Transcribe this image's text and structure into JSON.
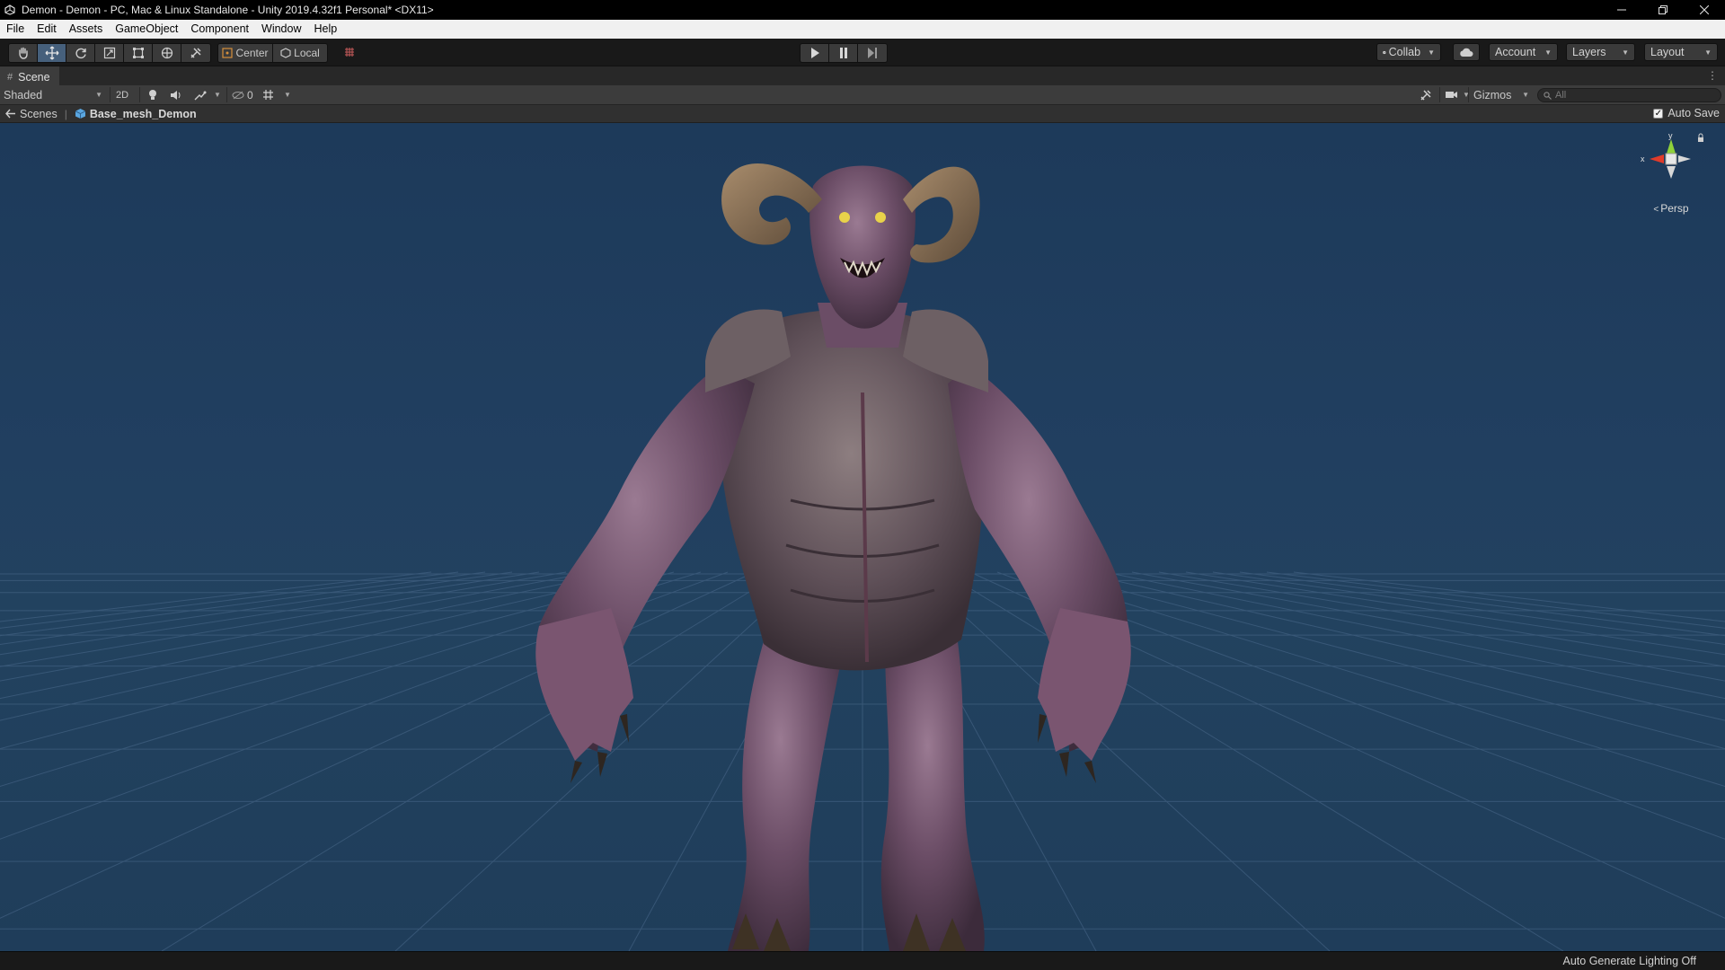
{
  "window": {
    "title": "Demon - Demon - PC, Mac & Linux Standalone - Unity 2019.4.32f1 Personal* <DX11>"
  },
  "menu": [
    "File",
    "Edit",
    "Assets",
    "GameObject",
    "Component",
    "Window",
    "Help"
  ],
  "toolbar": {
    "tools": [
      "hand-tool",
      "move-tool",
      "rotate-tool",
      "scale-tool",
      "rect-tool",
      "transform-tool",
      "custom-tool"
    ],
    "active_tool": "move-tool",
    "pivot_label": "Center",
    "space_label": "Local",
    "collab_label": "Collab",
    "account_label": "Account",
    "layers_label": "Layers",
    "layout_label": "Layout"
  },
  "scene_tab": {
    "label": "Scene"
  },
  "scene_toolbar": {
    "draw_mode": "Shaded",
    "mode_2d": "2D",
    "hidden_count": "0",
    "gizmos_label": "Gizmos",
    "search_placeholder": "All"
  },
  "breadcrumb": {
    "root": "Scenes",
    "current": "Base_mesh_Demon"
  },
  "auto_save": {
    "label": "Auto Save",
    "checked": true
  },
  "scene_gizmo": {
    "y_label": "y",
    "x_label": "x",
    "projection_label": "Persp",
    "colors": {
      "x": "#e03b2a",
      "y": "#8fd13a",
      "z": "#d8d8d8"
    }
  },
  "viewport": {
    "background": "#213f60",
    "grid_color": "#4b6a8c"
  },
  "status": {
    "text": "Auto Generate Lighting Off"
  }
}
